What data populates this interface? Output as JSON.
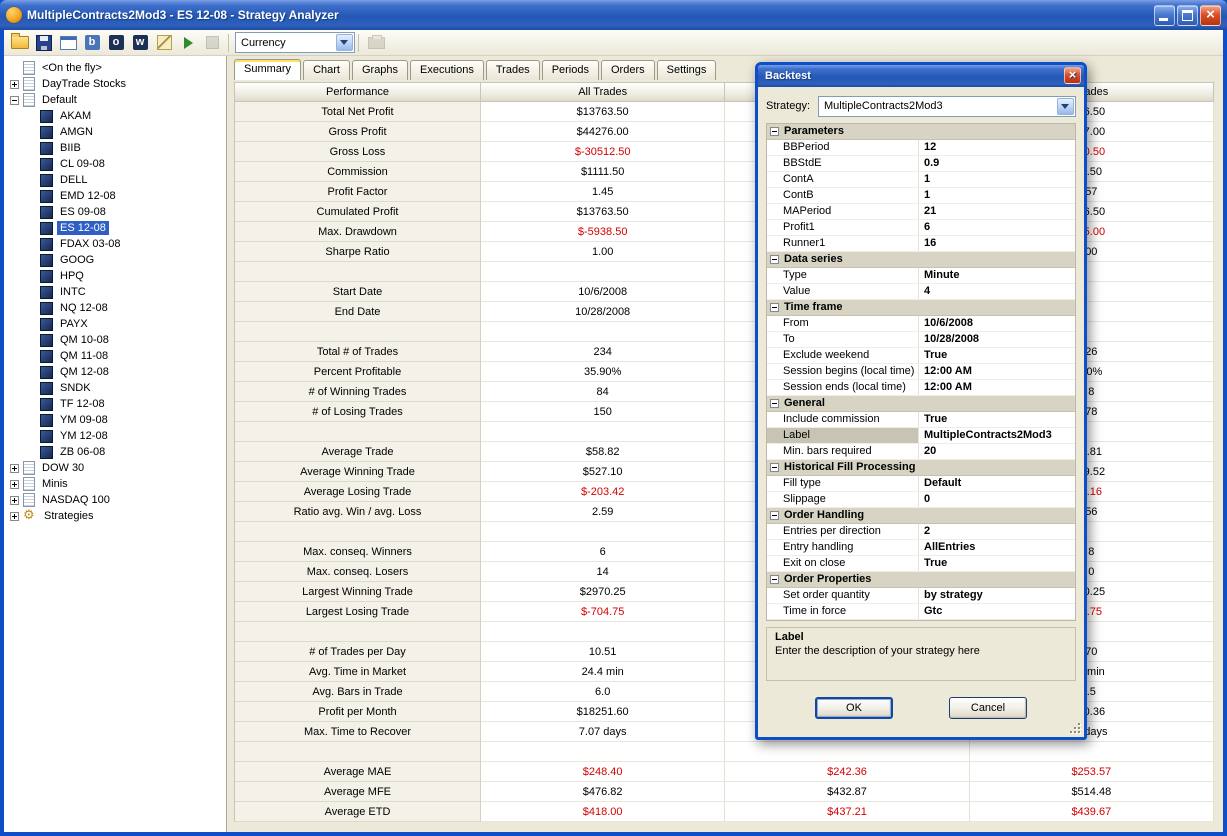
{
  "window": {
    "title": "MultipleContracts2Mod3 - ES 12-08 - Strategy Analyzer"
  },
  "toolbar": {
    "display_unit": "Currency",
    "icons_left": [
      {
        "id": "open",
        "kind": "folder"
      },
      {
        "id": "save",
        "kind": "save"
      },
      {
        "id": "new-window",
        "kind": "window"
      },
      {
        "id": "backtest",
        "kind": "letter",
        "glyph": "b",
        "bg": "#4a76b8"
      },
      {
        "id": "optimize",
        "kind": "letter",
        "glyph": "o",
        "bg": "#1d3156"
      },
      {
        "id": "walk-forward",
        "kind": "letter",
        "glyph": "w",
        "bg": "#1d3156"
      },
      {
        "id": "edit-strategy",
        "kind": "edit"
      },
      {
        "id": "run",
        "kind": "run"
      },
      {
        "id": "stop",
        "kind": "stop",
        "disabled": true
      }
    ],
    "icons_right": [
      {
        "id": "print",
        "kind": "print",
        "disabled": true
      }
    ]
  },
  "tree": {
    "items": [
      {
        "label": "<On the fly>",
        "level": 0,
        "icon": "doc"
      },
      {
        "label": "DayTrade Stocks",
        "level": 0,
        "exp": "+",
        "icon": "doc"
      },
      {
        "label": "Default",
        "level": 0,
        "exp": "-",
        "icon": "doc"
      },
      {
        "label": "AKAM",
        "level": 1,
        "icon": "inst"
      },
      {
        "label": "AMGN",
        "level": 1,
        "icon": "inst"
      },
      {
        "label": "BIIB",
        "level": 1,
        "icon": "inst"
      },
      {
        "label": "CL 09-08",
        "level": 1,
        "icon": "inst"
      },
      {
        "label": "DELL",
        "level": 1,
        "icon": "inst"
      },
      {
        "label": "EMD 12-08",
        "level": 1,
        "icon": "inst"
      },
      {
        "label": "ES 09-08",
        "level": 1,
        "icon": "inst"
      },
      {
        "label": "ES 12-08",
        "level": 1,
        "icon": "inst",
        "selected": true
      },
      {
        "label": "FDAX 03-08",
        "level": 1,
        "icon": "inst"
      },
      {
        "label": "GOOG",
        "level": 1,
        "icon": "inst"
      },
      {
        "label": "HPQ",
        "level": 1,
        "icon": "inst"
      },
      {
        "label": "INTC",
        "level": 1,
        "icon": "inst"
      },
      {
        "label": "NQ 12-08",
        "level": 1,
        "icon": "inst"
      },
      {
        "label": "PAYX",
        "level": 1,
        "icon": "inst"
      },
      {
        "label": "QM 10-08",
        "level": 1,
        "icon": "inst"
      },
      {
        "label": "QM 11-08",
        "level": 1,
        "icon": "inst"
      },
      {
        "label": "QM 12-08",
        "level": 1,
        "icon": "inst"
      },
      {
        "label": "SNDK",
        "level": 1,
        "icon": "inst"
      },
      {
        "label": "TF 12-08",
        "level": 1,
        "icon": "inst"
      },
      {
        "label": "YM 09-08",
        "level": 1,
        "icon": "inst"
      },
      {
        "label": "YM 12-08",
        "level": 1,
        "icon": "inst"
      },
      {
        "label": "ZB 06-08",
        "level": 1,
        "icon": "inst"
      },
      {
        "label": "DOW 30",
        "level": 0,
        "exp": "+",
        "icon": "doc"
      },
      {
        "label": "Minis",
        "level": 0,
        "exp": "+",
        "icon": "doc"
      },
      {
        "label": "NASDAQ 100",
        "level": 0,
        "exp": "+",
        "icon": "doc"
      },
      {
        "label": "Strategies",
        "level": 0,
        "exp": "+",
        "icon": "gear"
      }
    ]
  },
  "tabs": {
    "labels": [
      "Summary",
      "Chart",
      "Graphs",
      "Executions",
      "Trades",
      "Periods",
      "Orders",
      "Settings"
    ],
    "active": "Summary"
  },
  "table": {
    "headers": [
      "Performance",
      "All Trades",
      "",
      "Trades"
    ],
    "rows": [
      [
        "Total Net Profit",
        "$13763.50",
        0,
        "",
        0,
        "26.50",
        0
      ],
      [
        "Gross Profit",
        "$44276.00",
        0,
        "",
        0,
        "97.00",
        0
      ],
      [
        "Gross Loss",
        "$-30512.50",
        1,
        "",
        0,
        "70.50",
        1
      ],
      [
        "Commission",
        "$1111.50",
        0,
        "",
        0,
        "8.50",
        0
      ],
      [
        "Profit Factor",
        "1.45",
        0,
        "",
        0,
        "57",
        0
      ],
      [
        "Cumulated Profit",
        "$13763.50",
        0,
        "",
        0,
        "26.50",
        0
      ],
      [
        "Max. Drawdown",
        "$-5938.50",
        1,
        "",
        0,
        "95.00",
        1
      ],
      [
        "Sharpe Ratio",
        "1.00",
        0,
        "",
        0,
        "00",
        0
      ],
      [
        "",
        "",
        0,
        "",
        0,
        "",
        0
      ],
      [
        "Start Date",
        "10/6/2008",
        0,
        "",
        0,
        "",
        0
      ],
      [
        "End Date",
        "10/28/2008",
        0,
        "",
        0,
        "",
        0
      ],
      [
        "",
        "",
        0,
        "",
        0,
        "",
        0
      ],
      [
        "Total # of Trades",
        "234",
        0,
        "",
        0,
        "26",
        0
      ],
      [
        "Percent Profitable",
        "35.90%",
        0,
        "",
        0,
        "10%",
        0
      ],
      [
        "# of Winning Trades",
        "84",
        0,
        "",
        0,
        "8",
        0
      ],
      [
        "# of Losing Trades",
        "150",
        0,
        "",
        0,
        "78",
        0
      ],
      [
        "",
        "",
        0,
        "",
        0,
        "",
        0
      ],
      [
        "Average Trade",
        "$58.82",
        0,
        "",
        0,
        "4.81",
        0
      ],
      [
        "Average Winning Trade",
        "$527.10",
        0,
        "",
        0,
        "49.52",
        0
      ],
      [
        "Average Losing Trade",
        "$-203.42",
        1,
        "",
        0,
        "1.16",
        1
      ],
      [
        "Ratio avg. Win / avg. Loss",
        "2.59",
        0,
        "",
        0,
        "56",
        0
      ],
      [
        "",
        "",
        0,
        "",
        0,
        "",
        0
      ],
      [
        "Max. conseq. Winners",
        "6",
        0,
        "",
        0,
        "8",
        0
      ],
      [
        "Max. conseq. Losers",
        "14",
        0,
        "",
        0,
        "0",
        0
      ],
      [
        "Largest Winning Trade",
        "$2970.25",
        0,
        "",
        0,
        "70.25",
        0
      ],
      [
        "Largest Losing Trade",
        "$-704.75",
        1,
        "",
        0,
        "9.75",
        1
      ],
      [
        "",
        "",
        0,
        "",
        0,
        "",
        0
      ],
      [
        "# of Trades per Day",
        "10.51",
        0,
        "",
        0,
        "70",
        0
      ],
      [
        "Avg. Time in Market",
        "24.4 min",
        0,
        "",
        0,
        "2 min",
        0
      ],
      [
        "Avg. Bars in Trade",
        "6.0",
        0,
        "",
        0,
        ".5",
        0
      ],
      [
        "Profit per Month",
        "$18251.60",
        0,
        "",
        0,
        "00.36",
        0
      ],
      [
        "Max. Time to Recover",
        "7.07 days",
        0,
        "",
        0,
        "3 days",
        0
      ],
      [
        "",
        "",
        0,
        "",
        0,
        "",
        0
      ],
      [
        "Average MAE",
        "$248.40",
        1,
        "$242.36",
        1,
        "$253.57",
        1
      ],
      [
        "Average MFE",
        "$476.82",
        0,
        "$432.87",
        0,
        "$514.48",
        0
      ],
      [
        "Average ETD",
        "$418.00",
        1,
        "$437.21",
        1,
        "$439.67",
        1
      ]
    ]
  },
  "dialog": {
    "title": "Backtest",
    "strategy_label": "Strategy:",
    "strategy_value": "MultipleContracts2Mod3",
    "grid": [
      {
        "c": "Parameters"
      },
      {
        "n": "BBPeriod",
        "v": "12"
      },
      {
        "n": "BBStdE",
        "v": "0.9"
      },
      {
        "n": "ContA",
        "v": "1"
      },
      {
        "n": "ContB",
        "v": "1"
      },
      {
        "n": "MAPeriod",
        "v": "21"
      },
      {
        "n": "Profit1",
        "v": "6"
      },
      {
        "n": "Runner1",
        "v": "16"
      },
      {
        "c": "Data series"
      },
      {
        "n": "Type",
        "v": "Minute"
      },
      {
        "n": "Value",
        "v": "4"
      },
      {
        "c": "Time frame"
      },
      {
        "n": "From",
        "v": "10/6/2008"
      },
      {
        "n": "To",
        "v": "10/28/2008"
      },
      {
        "n": "Exclude weekend",
        "v": "True"
      },
      {
        "n": "Session begins (local time)",
        "v": "12:00 AM"
      },
      {
        "n": "Session ends (local time)",
        "v": "12:00 AM"
      },
      {
        "c": "General"
      },
      {
        "n": "Include commission",
        "v": "True"
      },
      {
        "n": "Label",
        "v": "MultipleContracts2Mod3",
        "selected": true
      },
      {
        "n": "Min. bars required",
        "v": "20"
      },
      {
        "c": "Historical Fill Processing"
      },
      {
        "n": "Fill type",
        "v": "Default"
      },
      {
        "n": "Slippage",
        "v": "0"
      },
      {
        "c": "Order Handling"
      },
      {
        "n": "Entries per direction",
        "v": "2"
      },
      {
        "n": "Entry handling",
        "v": "AllEntries"
      },
      {
        "n": "Exit on close",
        "v": "True"
      },
      {
        "c": "Order Properties"
      },
      {
        "n": "Set order quantity",
        "v": "by strategy"
      },
      {
        "n": "Time in force",
        "v": "Gtc"
      }
    ],
    "description": {
      "title": "Label",
      "text": "Enter the description of your strategy here"
    },
    "buttons": {
      "ok": "OK",
      "cancel": "Cancel"
    }
  }
}
